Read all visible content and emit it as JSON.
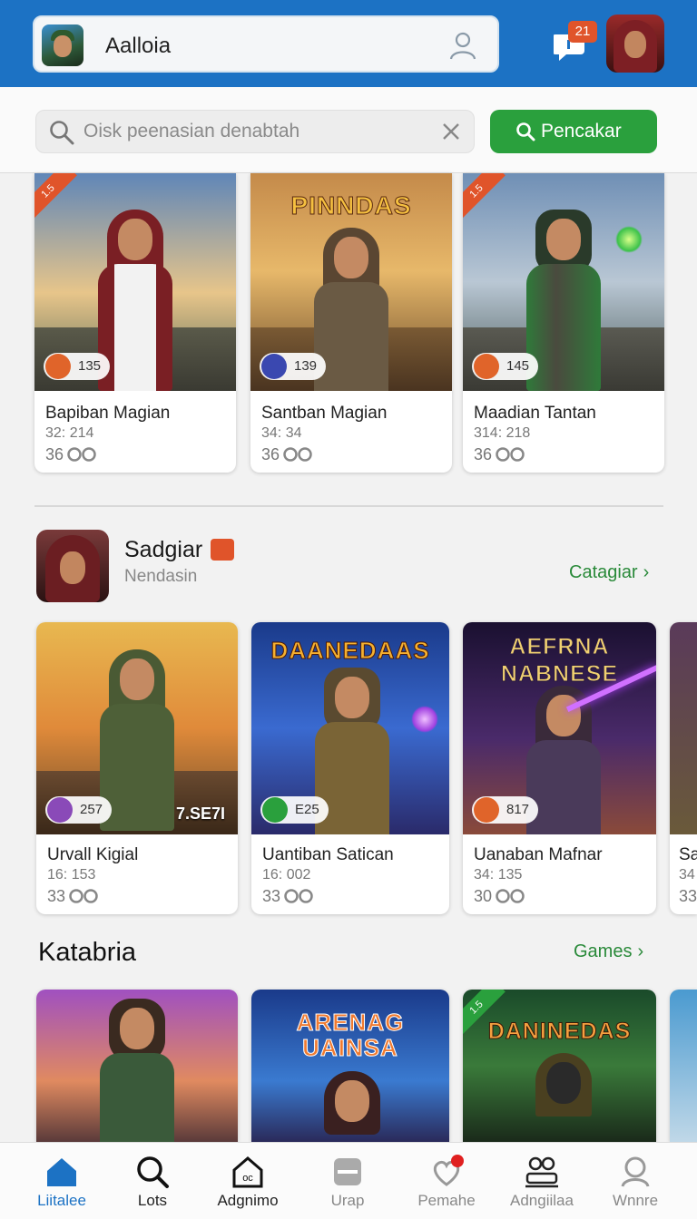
{
  "header": {
    "account_name": "Aalloia",
    "notification_count": "21"
  },
  "search": {
    "placeholder": "Oisk peenasian denabtah",
    "button_label": "Pencakar"
  },
  "row1": [
    {
      "title_art": "PINNDAS",
      "name": "Bapiban Magian",
      "sub": "32: 214",
      "rating": "36",
      "badge": "135"
    },
    {
      "title_art": "",
      "name": "Santban Magian",
      "sub": "34: 34",
      "rating": "36",
      "badge": "139"
    },
    {
      "title_art": "",
      "name": "Maadian Tantan",
      "sub": "314: 218",
      "rating": "36",
      "badge": "145"
    }
  ],
  "section": {
    "title": "Sadgiar",
    "subtitle": "Nendasin",
    "link": "Catagiar"
  },
  "row2": [
    {
      "title_art": "",
      "name": "Urvall Kigial",
      "sub": "16: 153",
      "rating": "33",
      "badge": "257",
      "extra": "7.SE7I"
    },
    {
      "title_art": "DAANEDAAS",
      "name": "Uantiban Satican",
      "sub": "16: 002",
      "rating": "33",
      "badge": "E25"
    },
    {
      "title_art": "AEFRNA NABNESE",
      "name": "Uanaban Mafnar",
      "sub": "34: 135",
      "rating": "30",
      "badge": "817"
    },
    {
      "name": "Sa",
      "sub": "34",
      "rating": "33"
    }
  ],
  "category": {
    "title": "Katabria",
    "link": "Games"
  },
  "row3": [
    {
      "title_art": ""
    },
    {
      "title_art": "ARENAG UAINSA"
    },
    {
      "title_art": "DANINEDAS"
    }
  ],
  "nav": [
    {
      "label": "Liitalee",
      "icon": "home-icon"
    },
    {
      "label": "Lots",
      "icon": "search-icon"
    },
    {
      "label": "Adgnimo",
      "icon": "store-icon"
    },
    {
      "label": "Urap",
      "icon": "card-icon"
    },
    {
      "label": "Pemahe",
      "icon": "heart-chat-icon"
    },
    {
      "label": "Adngiilaa",
      "icon": "group-icon"
    },
    {
      "label": "Wnnre",
      "icon": "profile-icon"
    }
  ],
  "colors": {
    "header_blue": "#1c72c4",
    "accent_green": "#2aa03d",
    "badge_orange": "#e0542a"
  }
}
